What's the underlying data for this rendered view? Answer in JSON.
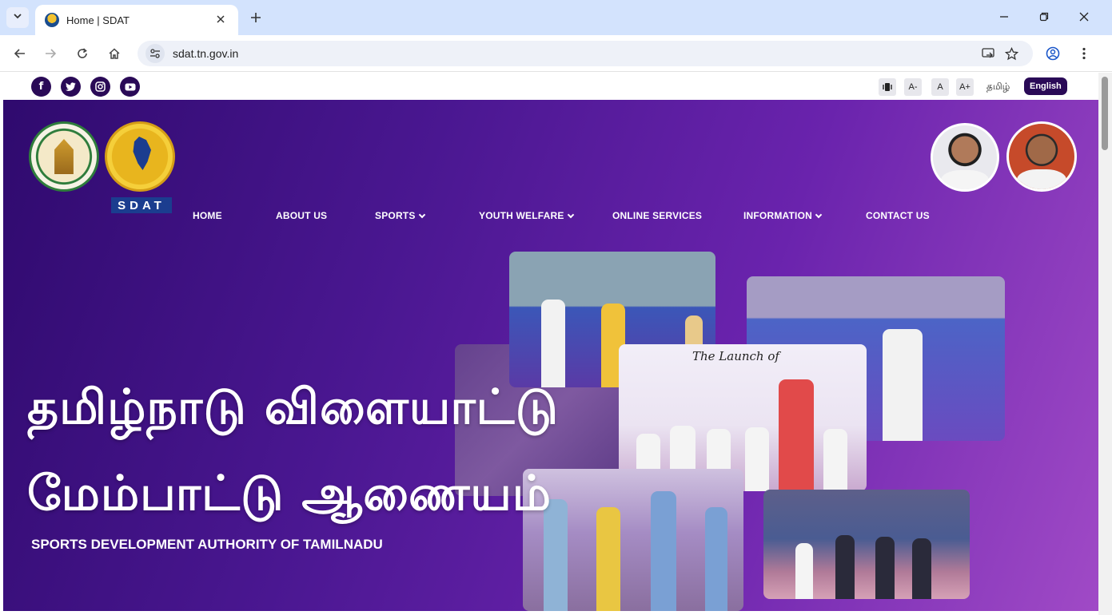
{
  "browser": {
    "tab_title": "Home | SDAT",
    "url": "sdat.tn.gov.in",
    "icons": {
      "tab_list": "chevron-down-icon",
      "close_tab": "close-icon",
      "new_tab": "plus-icon",
      "minimize": "minimize-icon",
      "restore": "restore-icon",
      "close_window": "close-icon",
      "back": "back-arrow-icon",
      "forward": "forward-arrow-icon",
      "reload": "reload-icon",
      "home": "home-icon",
      "site_info": "tune-icon",
      "cast": "cast-icon",
      "bookmark": "star-icon",
      "profile": "profile-icon",
      "menu": "more-vertical-icon"
    }
  },
  "utility": {
    "social": [
      "facebook-icon",
      "twitter-icon",
      "instagram-icon",
      "youtube-icon"
    ],
    "contrast_icon": "contrast-icon",
    "font_decrease": "A-",
    "font_normal": "A",
    "font_increase": "A+",
    "lang_tamil": "தமிழ்",
    "lang_english": "English"
  },
  "hero": {
    "sdat_logo_text": "SDAT",
    "nav": [
      {
        "label": "HOME",
        "dropdown": false
      },
      {
        "label": "ABOUT US",
        "dropdown": false
      },
      {
        "label": "SPORTS",
        "dropdown": true
      },
      {
        "label": "YOUTH WELFARE",
        "dropdown": true
      },
      {
        "label": "ONLINE SERVICES",
        "dropdown": false
      },
      {
        "label": "INFORMATION",
        "dropdown": true
      },
      {
        "label": "CONTACT US",
        "dropdown": false
      }
    ],
    "title_line1": "தமிழ்நாடு விளையாட்டு",
    "title_line2": "மேம்பாட்டு ஆணையம்",
    "subtitle": "SPORTS DEVELOPMENT AUTHORITY OF TAMILNADU",
    "launch_caption": "The Launch of"
  },
  "colors": {
    "hero_gradient_start": "#2f0a6e",
    "hero_gradient_end": "#a04ac6",
    "social_bg": "#2a0a57",
    "english_btn_bg": "#2a0a57",
    "tab_strip": "#d3e3fd"
  }
}
